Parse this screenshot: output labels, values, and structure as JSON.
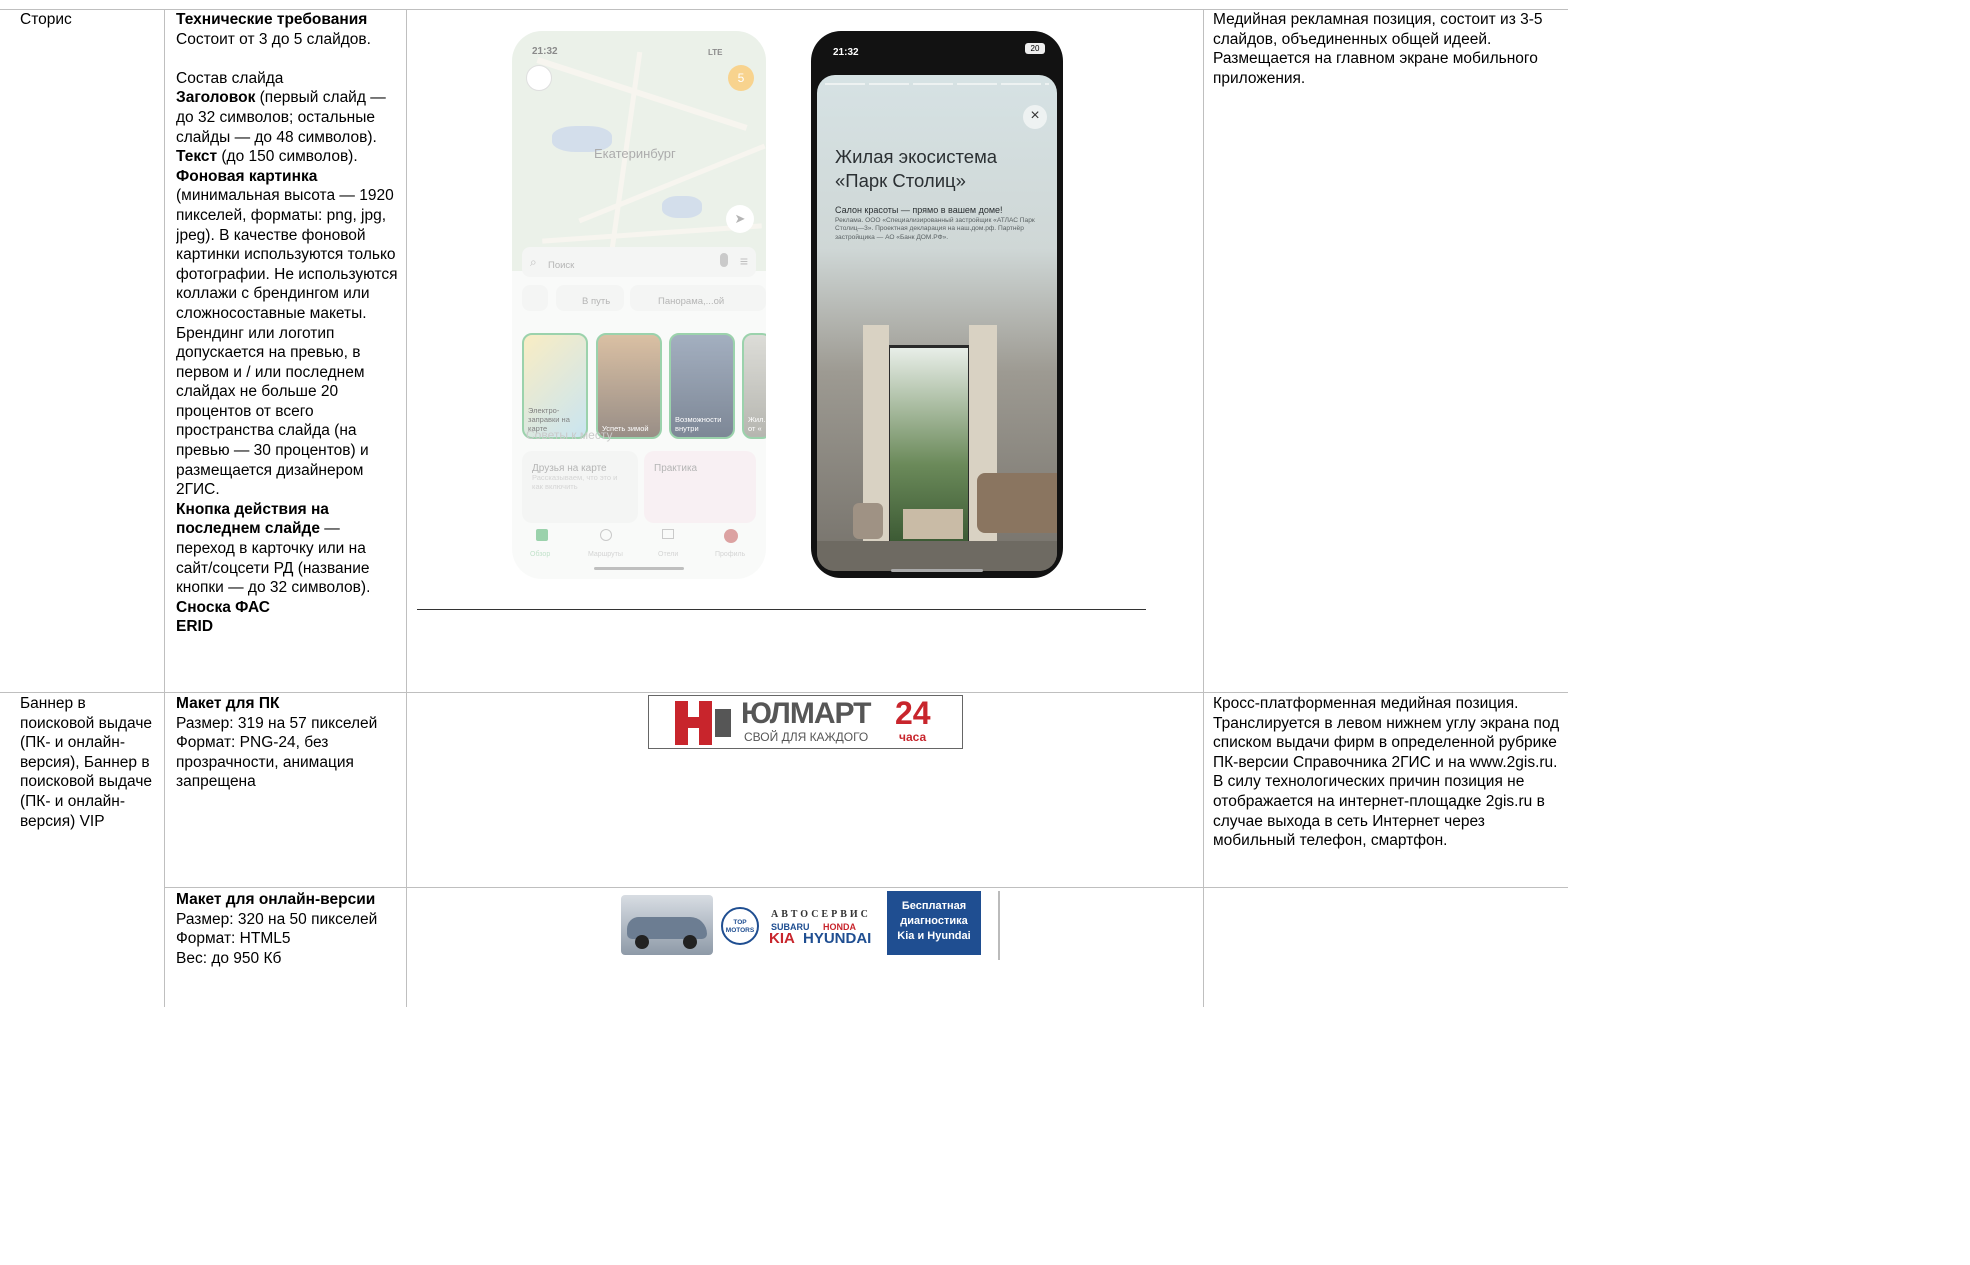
{
  "rows": [
    {
      "type_label": "Сторис",
      "requirements": {
        "title": "Технические требования",
        "intro": "Состоит от 3 до 5 слайдов.",
        "composition_label": "Состав слайда",
        "headline_label": "Заголовок",
        "headline_text": " (первый слайд — до 32 символов; остальные слайды — до 48 символов).",
        "text_label": "Текст",
        "text_text": " (до 150 символов).",
        "bg_label": "Фоновая картинка",
        "bg_text": " (минимальная высота — 1920 пикселей, форматы: png, jpg, jpeg). В качестве фоновой картинки используются только фотографии. Не используются коллажи с брендингом или сложносоставные макеты. Брендинг или логотип допускается на превью, в первом и / или последнем слайдах не больше 20 процентов от всего пространства слайда (на превью — 30 процентов) и размещается дизайнером 2ГИС.",
        "cta_label": "Кнопка действия на последнем слайде",
        "cta_text": " — переход в карточку или на сайт/соцсети РД (название кнопки — до 32 символов).",
        "fas_label": "Сноска ФАС",
        "erid_label": "ERID"
      },
      "description": "Медийная рекламная позиция, состоит из 3-5 слайдов, объединенных общей идеей. Размещается на главном экране мобильного приложения."
    },
    {
      "type_label": "Баннер в поисковой выдаче (ПК- и онлайн-версия), Баннер в поисковой выдаче (ПК- и онлайн-версия) VIP",
      "requirements": {
        "title": "Макет для ПК",
        "size": "Размер: 319 на 57 пикселей",
        "format": "Формат: PNG-24, без прозрачности, анимация запрещена"
      },
      "description": "Кросс-платформенная медийная позиция. Транслируется в левом нижнем углу экрана под списком выдачи фирм в определенной рубрике ПК-версии Справочника 2ГИС и на www.2gis.ru. В силу технологических причин позиция не отображается на интернет-площадке 2gis.ru в случае выхода в сеть Интернет через мобильный телефон, смартфон."
    },
    {
      "requirements": {
        "title": "Макет для онлайн-версии",
        "size": "Размер: 320 на 50 пикселей",
        "format": "Формат: HTML5",
        "weight": "Вес: до 950 Кб"
      },
      "description": ""
    }
  ],
  "mockup_left": {
    "time": "21:32",
    "signal": "LTE",
    "city": "Екатеринбург",
    "search_placeholder": "Поиск",
    "chip_route": "В путь",
    "chip_panorama": "Панорама,...ой",
    "stories": [
      "Электро-заправки на карте",
      "Успеть зимой",
      "Возможности внутри",
      "Жил... от «"
    ],
    "tips_title": "Советы к месту",
    "tip_card_1_title": "Друзья на карте",
    "tip_card_1_text": "Рассказываем, что это и как включить",
    "tip_card_2_title": "Практика",
    "nav_items": [
      "Обзор",
      "Маршруты",
      "Отели",
      "Профиль"
    ]
  },
  "mockup_right": {
    "time": "21:32",
    "battery": "20",
    "title": "Жилая экосистема «Парк Столиц»",
    "subtitle": "Салон красоты — прямо в вашем доме!",
    "disclaimer": "Реклама. ООО «Специализированный застройщик «АТЛАС Парк Столиц—3». Проектная декларация на наш.дом.рф. Партнёр застройщика — АО «Банк ДОМ.РФ».",
    "close_icon": "×"
  },
  "banner_pc": {
    "brand": "ЮЛМАРТ",
    "hours": "24",
    "hours_word": "часа",
    "tagline": "СВОЙ ДЛЯ КАЖДОГО"
  },
  "banner_online": {
    "service": "АВТОСЕРВИС",
    "brand1": "SUBARU",
    "brand2": "HONDA",
    "brand3": "KIA",
    "brand4": "HYUNDAI",
    "top_logo_1": "TOP",
    "top_logo_2": "MOTORS",
    "offer_line1": "Бесплатная",
    "offer_line2": "диагностика",
    "offer_line3": "Kia и Hyundai"
  },
  "colors": {
    "grid": "#bfbfbf",
    "ulmart_red": "#c8252c",
    "ulmart_gray": "#565656",
    "offer_blue": "#1f4e91",
    "green": "#5fb77a"
  }
}
